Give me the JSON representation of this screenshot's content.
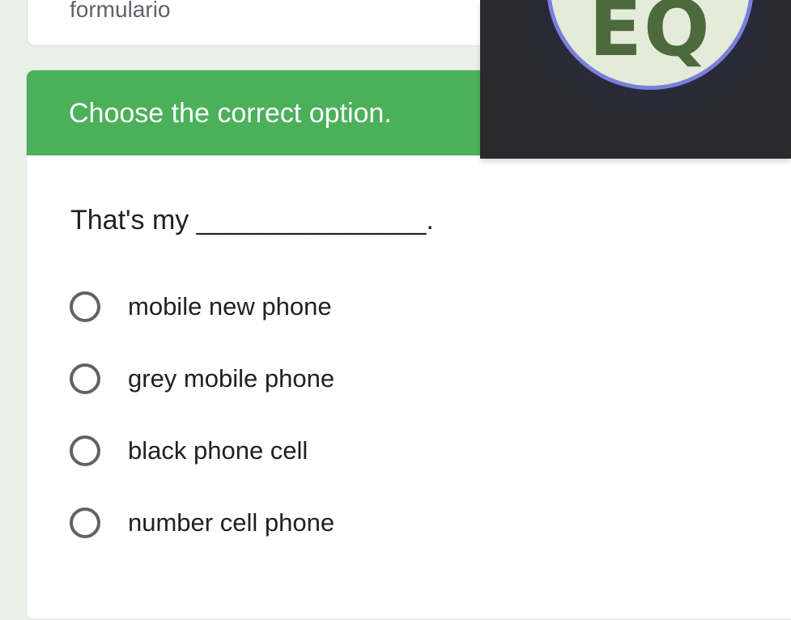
{
  "previous_card": {
    "partial_text": "formulario"
  },
  "section": {
    "title": "Choose the correct option.",
    "question": "That's my _______________.",
    "options": [
      {
        "label": "mobile new phone"
      },
      {
        "label": "grey mobile phone"
      },
      {
        "label": "black phone cell"
      },
      {
        "label": "number cell phone"
      }
    ]
  },
  "video_overlay": {
    "avatar_initials": "EQ"
  },
  "colors": {
    "header_green": "#4bb05a",
    "page_background": "#e8f2e6",
    "avatar_ring": "#7b7fdc",
    "avatar_fill": "#e4ecd9",
    "initials": "#4c6a3c",
    "radio_border": "#5f6368"
  }
}
